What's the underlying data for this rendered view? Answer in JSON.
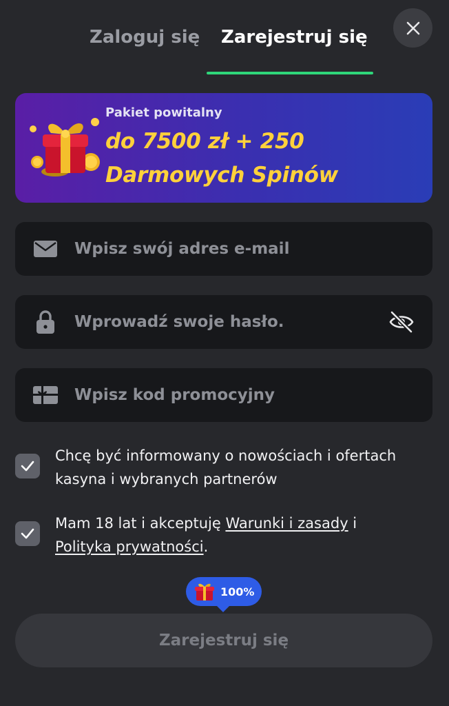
{
  "tabs": {
    "login_label": "Zaloguj się",
    "register_label": "Zarejestruj się",
    "active": "register"
  },
  "close_icon": "close-icon",
  "colors": {
    "accent_green": "#2fd67a",
    "promo_yellow": "#ffd13b",
    "bonus_blue": "#2e5ce6",
    "background": "#27282c",
    "field_background": "#17181b"
  },
  "promo": {
    "kicker": "Pakiet powitalny",
    "line1": "do 7500 zł + 250",
    "line2": "Darmowych Spinów",
    "icon": "gift-box-icon"
  },
  "form": {
    "email": {
      "placeholder": "Wpisz swój adres e-mail",
      "value": "",
      "icon": "envelope-icon"
    },
    "password": {
      "placeholder": "Wprowadź swoje hasło.",
      "value": "",
      "icon": "lock-icon",
      "toggle_icon": "eye-off-icon"
    },
    "promo_code": {
      "placeholder": "Wpisz kod promocyjny",
      "value": "",
      "icon": "gift-card-icon"
    }
  },
  "consents": {
    "newsletter": {
      "checked": true,
      "text": "Chcę być informowany o nowościach i ofertach kasyna i wybranych partnerów"
    },
    "terms": {
      "checked": true,
      "prefix": "Mam 18 lat i akceptuję ",
      "terms_link": "Warunki i zasady",
      "middle": " i ",
      "privacy_link": "Polityka prywatności",
      "suffix": "."
    }
  },
  "bonus_badge": {
    "value": "100%",
    "icon": "gift-icon"
  },
  "submit": {
    "label": "Zarejestruj się"
  }
}
